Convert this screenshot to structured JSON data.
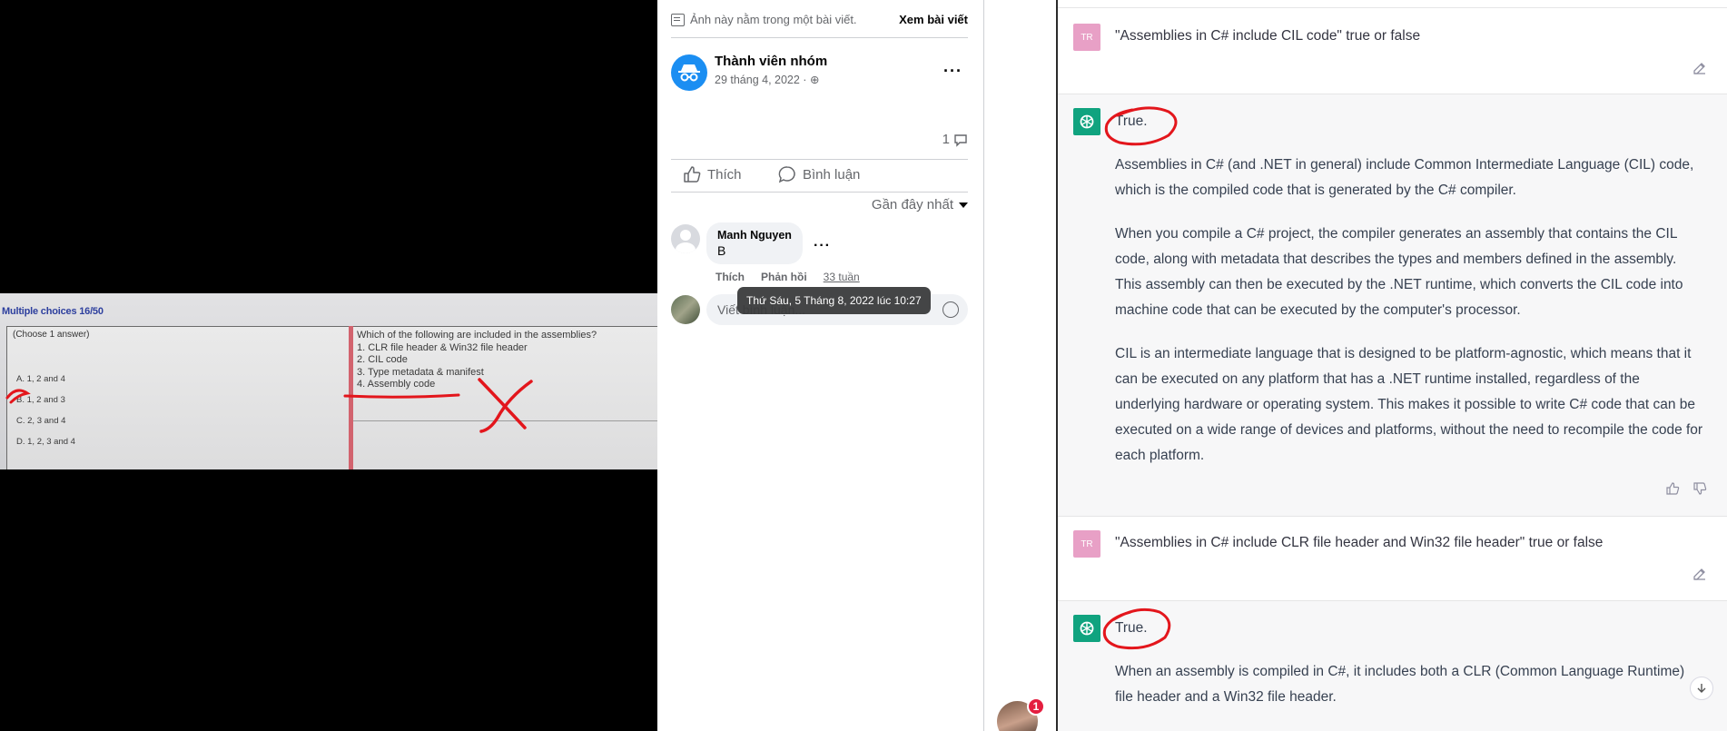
{
  "photo": {
    "title": "Multiple choices 16/50",
    "instruction": "(Choose 1 answer)",
    "question": "Which of the following are included in the assemblies?\n1. CLR file header & Win32 file header\n2. CIL code\n3. Type metadata & manifest\n4. Assembly code",
    "answers": [
      "A.  1, 2 and 4",
      "B.  1, 2 and 3",
      "C.  2, 3 and 4",
      "D.  1, 2, 3 and 4"
    ]
  },
  "fb": {
    "note": "Ảnh này nằm trong một bài viết.",
    "view_post": "Xem bài viết",
    "author": "Thành viên nhóm",
    "date": "29 tháng 4, 2022 · ",
    "comment_count": "1",
    "like": "Thích",
    "comment": "Bình luận",
    "sort": "Gần đây nhất",
    "comment_item": {
      "name": "Manh Nguyen",
      "text": "B",
      "like": "Thích",
      "reply": "Phản hồi",
      "time": "33 tuần"
    },
    "write_placeholder": "Viết bình luận...",
    "tooltip": "Thứ Sáu, 5 Tháng 8, 2022 lúc 10:27",
    "notif_count": "1"
  },
  "chat": {
    "user_initials": "TR",
    "q1": "\"Assemblies in C# include CIL code\" true or false",
    "a1_head": "True.",
    "a1_paragraphs": [
      "Assemblies in C# (and .NET in general) include Common Intermediate Language (CIL) code, which is the compiled code that is generated by the C# compiler.",
      "When you compile a C# project, the compiler generates an assembly that contains the CIL code, along with metadata that describes the types and members defined in the assembly. This assembly can then be executed by the .NET runtime, which converts the CIL code into machine code that can be executed by the computer's processor.",
      "CIL is an intermediate language that is designed to be platform-agnostic, which means that it can be executed on any platform that has a .NET runtime installed, regardless of the underlying hardware or operating system. This makes it possible to write C# code that can be executed on a wide range of devices and platforms, without the need to recompile the code for each platform."
    ],
    "q2": "\"Assemblies in C# include CLR file header and Win32 file header\" true or false",
    "a2_head": "True.",
    "a2_paragraphs": [
      "When an assembly is compiled in C#, it includes both a CLR (Common Language Runtime) file header and a Win32 file header."
    ]
  },
  "colors": {
    "fb_blue": "#1b8ef2",
    "openai_green": "#10a37f",
    "user_avatar": "#e8a0c6",
    "annotation_red": "#e3161c"
  }
}
